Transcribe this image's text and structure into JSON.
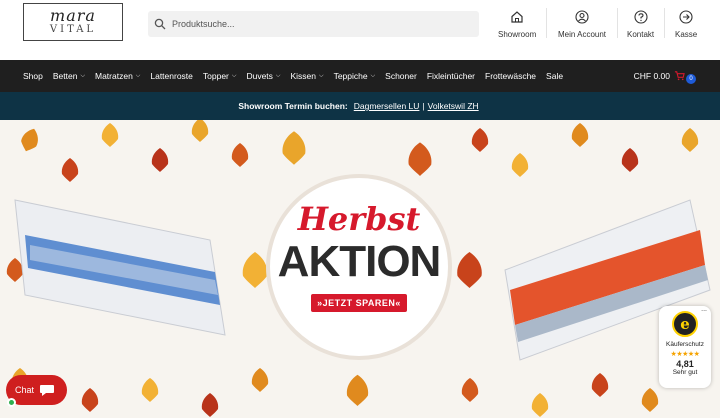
{
  "logo": {
    "word": "mara",
    "sub": "VITAL"
  },
  "search": {
    "placeholder": "Produktsuche..."
  },
  "header_icons": [
    {
      "name": "home-icon",
      "label": "Showroom"
    },
    {
      "name": "user-icon",
      "label": "Mein Account"
    },
    {
      "name": "help-icon",
      "label": "Kontakt"
    },
    {
      "name": "arrow-right-icon",
      "label": "Kasse"
    }
  ],
  "nav": {
    "items": [
      {
        "label": "Shop",
        "has_dropdown": false
      },
      {
        "label": "Betten",
        "has_dropdown": true
      },
      {
        "label": "Matratzen",
        "has_dropdown": true
      },
      {
        "label": "Lattenroste",
        "has_dropdown": false
      },
      {
        "label": "Topper",
        "has_dropdown": true
      },
      {
        "label": "Duvets",
        "has_dropdown": true
      },
      {
        "label": "Kissen",
        "has_dropdown": true
      },
      {
        "label": "Teppiche",
        "has_dropdown": true
      },
      {
        "label": "Schoner",
        "has_dropdown": false
      },
      {
        "label": "Fixleintücher",
        "has_dropdown": false
      },
      {
        "label": "Frottеwäsche",
        "has_dropdown": false
      },
      {
        "label": "Sale",
        "has_dropdown": false
      }
    ],
    "cart_total": "CHF 0.00",
    "cart_count": "0"
  },
  "announcement": {
    "lead": "Showroom Termin buchen:",
    "link1": "Dagmersellen LU",
    "separator": "|",
    "link2": "Volketswil ZH"
  },
  "hero": {
    "script_text": "Herbst",
    "headline": "AKTION",
    "cta": "»JETZT SPAREN«"
  },
  "chat": {
    "label": "Chat"
  },
  "trust": {
    "logo_letter": "e",
    "label": "Käuferschutz",
    "stars": "★★★★★",
    "score": "4,81",
    "rating": "Sehr gut",
    "more": "..."
  },
  "colors": {
    "nav_bg": "#1f1f1f",
    "bar_bg": "#0e3345",
    "accent_red": "#d6192c",
    "cart_badge": "#1e5bd8"
  }
}
